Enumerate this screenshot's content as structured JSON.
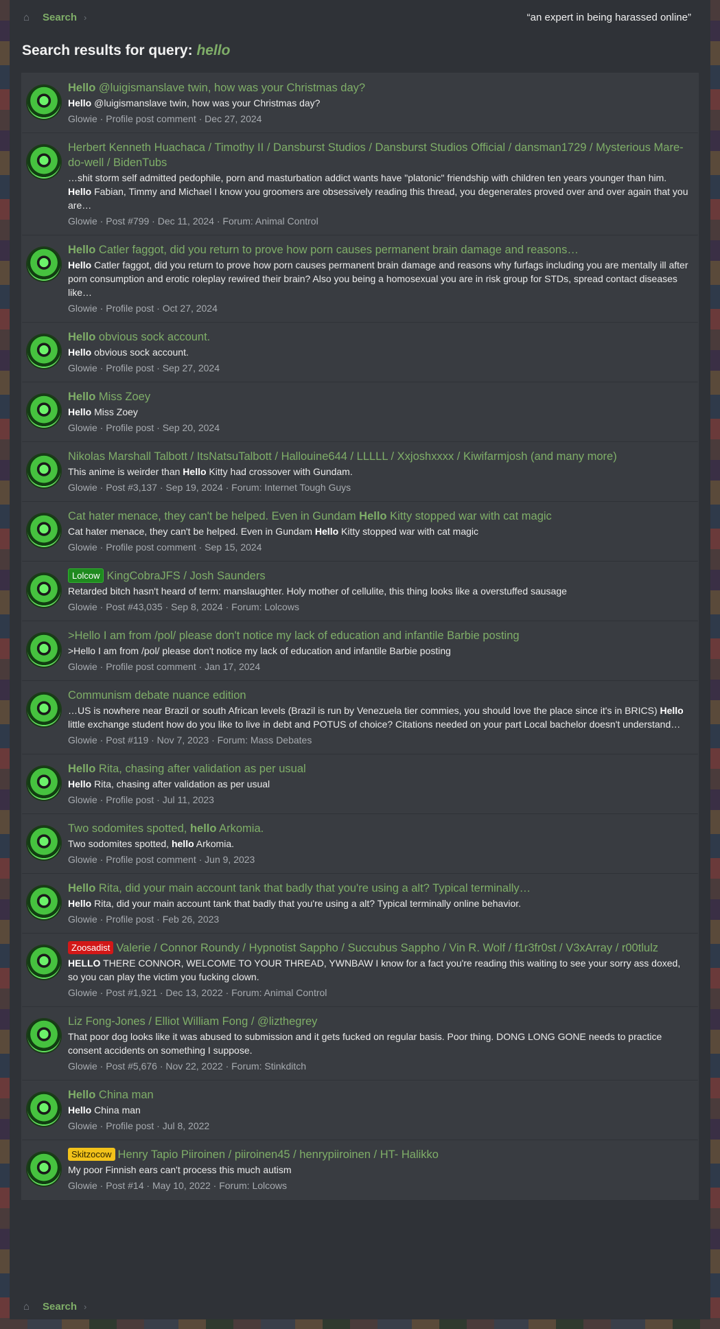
{
  "breadcrumb": {
    "label": "Search",
    "tagline": "“an expert in being harassed online”"
  },
  "heading": {
    "prefix": "Search results for query:",
    "query": "hello"
  },
  "results": [
    {
      "title_parts": [
        {
          "t": "Hello",
          "b": true
        },
        {
          "t": " @luigismanslave twin, how was your Christmas day?"
        }
      ],
      "snippet_parts": [
        {
          "t": "Hello",
          "b": true
        },
        {
          "t": " @luigismanslave twin, how was your Christmas day?"
        }
      ],
      "meta": "Glowie · Profile post comment · Dec 27, 2024"
    },
    {
      "title_parts": [
        {
          "t": "Herbert Kenneth Huachaca / Timothy II / Dansburst Studios / Dansburst Studios Official / dansman1729 / Mysterious Mare-do-well / BidenTubs"
        }
      ],
      "snippet_parts": [
        {
          "t": "…shit storm self admitted pedophile, porn and masturbation addict wants have \"platonic\" friendship with children ten years younger than him. "
        },
        {
          "t": "Hello",
          "b": true
        },
        {
          "t": " Fabian, Timmy and Michael I know you groomers are obsessively reading this thread, you degenerates proved over and over again that you are…"
        }
      ],
      "meta": "Glowie · Post #799 · Dec 11, 2024 · Forum: Animal Control"
    },
    {
      "title_parts": [
        {
          "t": "Hello",
          "b": true
        },
        {
          "t": " Catler faggot, did you return to prove how porn causes permanent brain damage and reasons…"
        }
      ],
      "snippet_parts": [
        {
          "t": "Hello",
          "b": true
        },
        {
          "t": " Catler faggot, did you return to prove how porn causes permanent brain damage and reasons why furfags including you are mentally ill after porn consumption and erotic roleplay rewired their brain? Also you being a homosexual you are in risk group for STDs, spread contact diseases like…"
        }
      ],
      "meta": "Glowie · Profile post · Oct 27, 2024"
    },
    {
      "title_parts": [
        {
          "t": "Hello",
          "b": true
        },
        {
          "t": " obvious sock account."
        }
      ],
      "snippet_parts": [
        {
          "t": "Hello",
          "b": true
        },
        {
          "t": " obvious sock account."
        }
      ],
      "meta": "Glowie · Profile post · Sep 27, 2024"
    },
    {
      "title_parts": [
        {
          "t": "Hello",
          "b": true
        },
        {
          "t": " Miss Zoey"
        }
      ],
      "snippet_parts": [
        {
          "t": "Hello",
          "b": true
        },
        {
          "t": " Miss Zoey"
        }
      ],
      "meta": "Glowie · Profile post · Sep 20, 2024"
    },
    {
      "title_parts": [
        {
          "t": "Nikolas Marshall Talbott / ItsNatsuTalbott / Hallouine644 / LLLLL / Xxjoshxxxx / Kiwifarmjosh (and many more)"
        }
      ],
      "snippet_parts": [
        {
          "t": "This anime is weirder than "
        },
        {
          "t": "Hello",
          "b": true
        },
        {
          "t": " Kitty had crossover with Gundam."
        }
      ],
      "meta": "Glowie · Post #3,137 · Sep 19, 2024 · Forum: Internet Tough Guys"
    },
    {
      "title_parts": [
        {
          "t": "Cat hater menace, they can't be helped. Even in Gundam "
        },
        {
          "t": "Hello",
          "b": true
        },
        {
          "t": " Kitty stopped war with cat magic"
        }
      ],
      "snippet_parts": [
        {
          "t": "Cat hater menace, they can't be helped. Even in Gundam "
        },
        {
          "t": "Hello",
          "b": true
        },
        {
          "t": " Kitty stopped war with cat magic"
        }
      ],
      "meta": "Glowie · Profile post comment · Sep 15, 2024"
    },
    {
      "label": "Lolcow",
      "label_style": "green",
      "title_parts": [
        {
          "t": "KingCobraJFS / Josh Saunders"
        }
      ],
      "snippet_parts": [
        {
          "t": "Retarded bitch hasn't heard of term: manslaughter. Holy mother of cellulite, this thing looks like a overstuffed sausage"
        }
      ],
      "meta": "Glowie · Post #43,035 · Sep 8, 2024 · Forum: Lolcows"
    },
    {
      "title_parts": [
        {
          "t": ">Hello I am from /pol/ please don't notice my lack of education and infantile Barbie posting"
        }
      ],
      "snippet_parts": [
        {
          "t": ">Hello I am from /pol/ please don't notice my lack of education and infantile Barbie posting"
        }
      ],
      "meta": "Glowie · Profile post comment · Jan 17, 2024"
    },
    {
      "title_parts": [
        {
          "t": "Communism debate nuance edition"
        }
      ],
      "snippet_parts": [
        {
          "t": "…US is nowhere near Brazil or south African levels (Brazil is run by Venezuela tier commies, you should love the place since it's in BRICS) "
        },
        {
          "t": "Hello",
          "b": true
        },
        {
          "t": " little exchange student how do you like to live in debt and POTUS of choice? Citations needed on your part Local bachelor doesn't understand…"
        }
      ],
      "meta": "Glowie · Post #119 · Nov 7, 2023 · Forum: Mass Debates"
    },
    {
      "title_parts": [
        {
          "t": "Hello",
          "b": true
        },
        {
          "t": " Rita, chasing after validation as per usual"
        }
      ],
      "snippet_parts": [
        {
          "t": "Hello",
          "b": true
        },
        {
          "t": " Rita, chasing after validation as per usual"
        }
      ],
      "meta": "Glowie · Profile post · Jul 11, 2023"
    },
    {
      "title_parts": [
        {
          "t": "Two sodomites spotted, "
        },
        {
          "t": "hello",
          "b": true
        },
        {
          "t": " Arkomia."
        }
      ],
      "snippet_parts": [
        {
          "t": "Two sodomites spotted, "
        },
        {
          "t": "hello",
          "b": true
        },
        {
          "t": " Arkomia."
        }
      ],
      "meta": "Glowie · Profile post comment · Jun 9, 2023"
    },
    {
      "title_parts": [
        {
          "t": "Hello",
          "b": true
        },
        {
          "t": " Rita, did your main account tank that badly that you're using a alt? Typical terminally…"
        }
      ],
      "snippet_parts": [
        {
          "t": "Hello",
          "b": true
        },
        {
          "t": " Rita, did your main account tank that badly that you're using a alt? Typical terminally online behavior."
        }
      ],
      "meta": "Glowie · Profile post · Feb 26, 2023"
    },
    {
      "label": "Zoosadist",
      "label_style": "red",
      "title_parts": [
        {
          "t": "Valerie / Connor Roundy / Hypnotist Sappho / Succubus Sappho / Vin R. Wolf / f1r3fr0st / V3xArray / r00tlulz"
        }
      ],
      "snippet_parts": [
        {
          "t": "HELLO",
          "b": true
        },
        {
          "t": " THERE CONNOR, WELCOME TO YOUR THREAD, YWNBAW I know for a fact you're reading this waiting to see your sorry ass doxed, so you can play the victim you fucking clown."
        }
      ],
      "meta": "Glowie · Post #1,921 · Dec 13, 2022 · Forum: Animal Control"
    },
    {
      "title_parts": [
        {
          "t": "Liz Fong-Jones / Elliot William Fong / @lizthegrey"
        }
      ],
      "snippet_parts": [
        {
          "t": "That poor dog looks like it was abused to submission and it gets fucked on regular basis. Poor thing. DONG LONG GONE needs to practice consent accidents on something I suppose."
        }
      ],
      "meta": "Glowie · Post #5,676 · Nov 22, 2022 · Forum: Stinkditch"
    },
    {
      "title_parts": [
        {
          "t": "Hello",
          "b": true
        },
        {
          "t": " China man"
        }
      ],
      "snippet_parts": [
        {
          "t": "Hello",
          "b": true
        },
        {
          "t": " China man"
        }
      ],
      "meta": "Glowie · Profile post · Jul 8, 2022"
    },
    {
      "label": "Skitzocow",
      "label_style": "yellow",
      "title_parts": [
        {
          "t": "Henry Tapio Piiroinen / piiroinen45 / henrypiiroinen / HT- Halikko"
        }
      ],
      "snippet_parts": [
        {
          "t": "My poor Finnish ears can't process this much autism"
        }
      ],
      "meta": "Glowie · Post #14 · May 10, 2022 · Forum: Lolcows"
    }
  ]
}
